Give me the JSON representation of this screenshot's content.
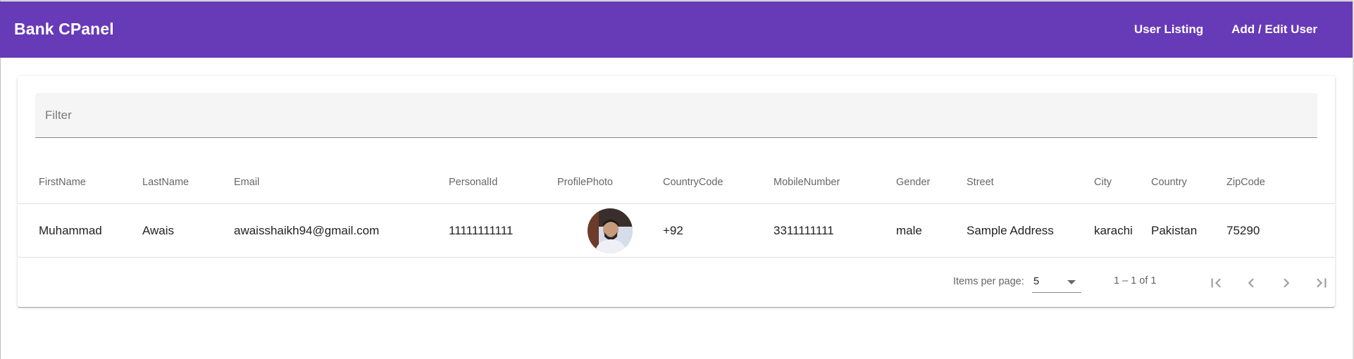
{
  "app": {
    "brand": "Bank CPanel",
    "nav": [
      {
        "label": "User Listing"
      },
      {
        "label": "Add / Edit User"
      }
    ],
    "accent_color": "#673ab7"
  },
  "filter": {
    "placeholder": "Filter",
    "value": ""
  },
  "table": {
    "columns": [
      "FirstName",
      "LastName",
      "Email",
      "PersonalId",
      "ProfilePhoto",
      "CountryCode",
      "MobileNumber",
      "Gender",
      "Street",
      "City",
      "Country",
      "ZipCode"
    ],
    "rows": [
      {
        "first_name": "Muhammad",
        "last_name": "Awais",
        "email": "awaisshaikh94@gmail.com",
        "personal_id": "11111111111",
        "profile_photo": "avatar-photo",
        "country_code": "+92",
        "mobile_number": "3311111111",
        "gender": "male",
        "street": "Sample Address",
        "city": "karachi",
        "country": "Pakistan",
        "zip_code": "75290"
      }
    ]
  },
  "paginator": {
    "items_per_page_label": "Items per page:",
    "items_per_page_value": "5",
    "range_label": "1 – 1 of 1",
    "buttons": [
      "first-page-icon",
      "previous-page-icon",
      "next-page-icon",
      "last-page-icon"
    ]
  }
}
